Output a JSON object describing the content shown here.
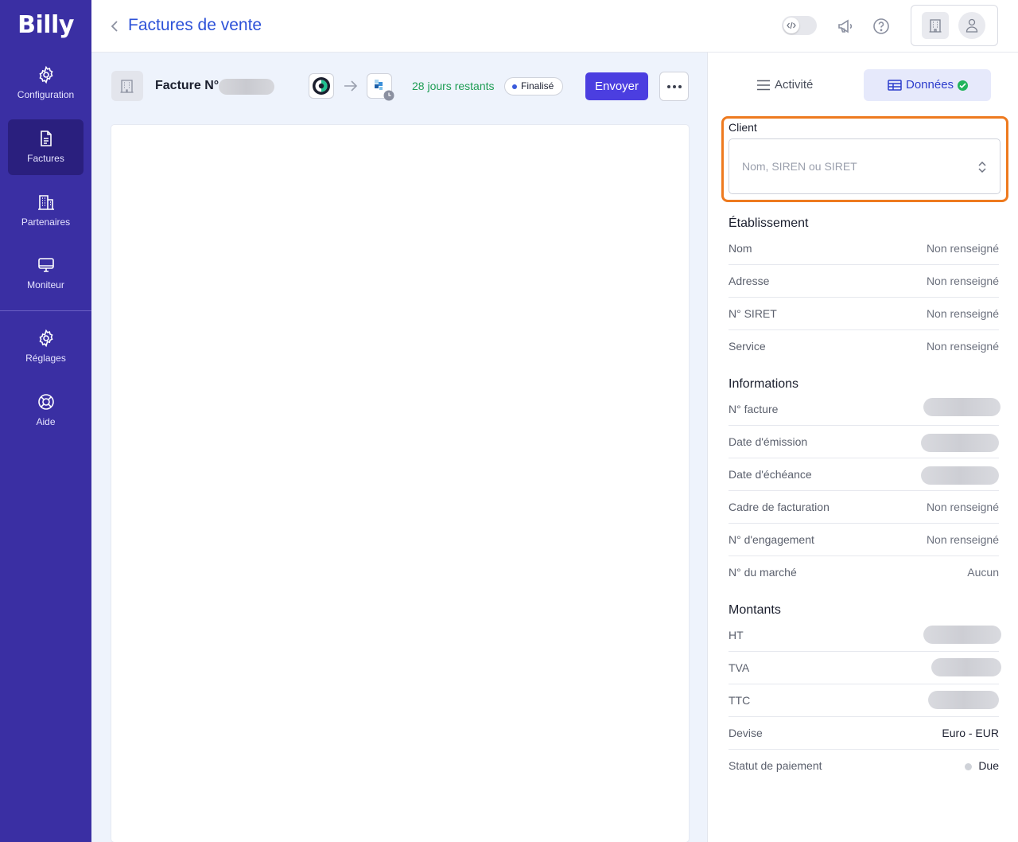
{
  "app": {
    "logo": "Billy"
  },
  "sidebar": {
    "items": [
      {
        "label": "Configuration",
        "icon": "gear-icon"
      },
      {
        "label": "Factures",
        "icon": "document-icon",
        "active": true
      },
      {
        "label": "Partenaires",
        "icon": "building-icon"
      },
      {
        "label": "Moniteur",
        "icon": "monitor-icon"
      },
      {
        "label": "Réglages",
        "icon": "gear-icon"
      },
      {
        "label": "Aide",
        "icon": "lifebuoy-icon"
      }
    ]
  },
  "header": {
    "title": "Factures de vente"
  },
  "invoice": {
    "title": "Facture N°",
    "days_left": "28 jours restants",
    "status": "Finalisé",
    "send_label": "Envoyer"
  },
  "panel": {
    "tabs": [
      {
        "label": "Activité",
        "icon": "list-icon"
      },
      {
        "label": "Données",
        "icon": "table-icon",
        "active": true
      }
    ],
    "client": {
      "label": "Client",
      "placeholder": "Nom, SIREN ou SIRET",
      "value": ""
    },
    "etablissement": {
      "title": "Établissement",
      "rows": [
        {
          "label": "Nom",
          "value": "Non renseigné"
        },
        {
          "label": "Adresse",
          "value": "Non renseigné"
        },
        {
          "label": "N° SIRET",
          "value": "Non renseigné"
        },
        {
          "label": "Service",
          "value": "Non renseigné"
        }
      ]
    },
    "informations": {
      "title": "Informations",
      "rows": [
        {
          "label": "N° facture",
          "value": null
        },
        {
          "label": "Date d'émission",
          "value": null
        },
        {
          "label": "Date d'échéance",
          "value": null
        },
        {
          "label": "Cadre de facturation",
          "value": "Non renseigné"
        },
        {
          "label": "N° d'engagement",
          "value": "Non renseigné"
        },
        {
          "label": "N° du marché",
          "value": "Aucun"
        }
      ]
    },
    "montants": {
      "title": "Montants",
      "rows": [
        {
          "label": "HT",
          "value": null
        },
        {
          "label": "TVA",
          "value": null
        },
        {
          "label": "TTC",
          "value": null
        },
        {
          "label": "Devise",
          "value": "Euro - EUR"
        },
        {
          "label": "Statut de paiement",
          "value": "Due"
        }
      ]
    }
  },
  "colors": {
    "sidebar_bg": "#3a2fa3",
    "accent": "#4b3ee0",
    "link": "#2d52d8",
    "success": "#1f9d55",
    "highlight": "#ee7a1f"
  }
}
